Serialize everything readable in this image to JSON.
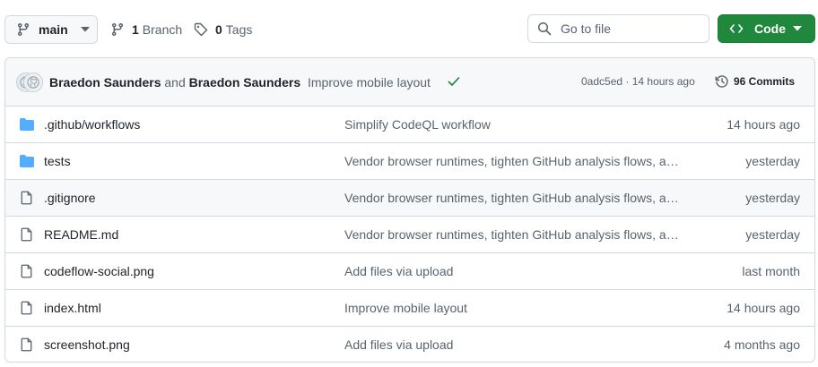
{
  "toolbar": {
    "branch_label": "main",
    "branches_count": "1",
    "branches_label": "Branch",
    "tags_count": "0",
    "tags_label": "Tags",
    "goto_placeholder": "Go to file",
    "code_label": "Code"
  },
  "commit": {
    "author1": "Braedon Saunders",
    "and": "and",
    "author2": "Braedon Saunders",
    "message": "Improve mobile layout",
    "sha_time": "0adc5ed · 14 hours ago",
    "commits_label": "96 Commits"
  },
  "files": [
    {
      "name": ".github/workflows",
      "type": "folder",
      "message": "Simplify CodeQL workflow",
      "age": "14 hours ago"
    },
    {
      "name": "tests",
      "type": "folder",
      "message": "Vendor browser runtimes, tighten GitHub analysis flows, a…",
      "age": "yesterday"
    },
    {
      "name": ".gitignore",
      "type": "file",
      "message": "Vendor browser runtimes, tighten GitHub analysis flows, a…",
      "age": "yesterday"
    },
    {
      "name": "README.md",
      "type": "file",
      "message": "Vendor browser runtimes, tighten GitHub analysis flows, a…",
      "age": "yesterday"
    },
    {
      "name": "codeflow-social.png",
      "type": "file",
      "message": "Add files via upload",
      "age": "last month"
    },
    {
      "name": "index.html",
      "type": "file",
      "message": "Improve mobile layout",
      "age": "14 hours ago"
    },
    {
      "name": "screenshot.png",
      "type": "file",
      "message": "Add files via upload",
      "age": "4 months ago"
    }
  ],
  "colors": {
    "code_button": "#1f883d",
    "folder_icon": "#54aeff",
    "check_icon": "#1a7f37",
    "muted_text": "#59636e"
  }
}
